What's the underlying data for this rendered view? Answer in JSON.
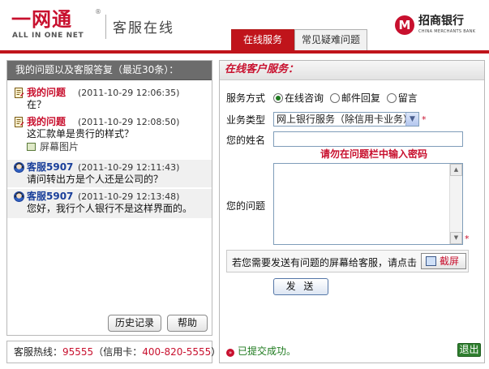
{
  "header": {
    "brand": "一网通",
    "brand_reg": "®",
    "brand_sub": "ALL IN ONE NET",
    "service_title": "客服在线",
    "bank_mark": "M",
    "bank_name": "招商银行",
    "bank_name_en": "CHINA MERCHANTS BANK",
    "tabs": [
      {
        "label": "在线服务",
        "active": true
      },
      {
        "label": "常见疑难问题",
        "active": false
      }
    ]
  },
  "left_panel": {
    "title": "我的问题以及客服答复（最近30条）：",
    "messages": [
      {
        "sender": "我的问题",
        "time": "(2011-10-29 12:06:35)",
        "text": "在？",
        "type": "user"
      },
      {
        "sender": "我的问题",
        "time": "(2011-10-29 12:08:50)",
        "text": "这汇款单是贵行的样式？",
        "type": "user",
        "attachment": "屏幕图片"
      },
      {
        "sender": "客服5907",
        "time": "(2011-10-29 12:11:43)",
        "text": "请问转出方是个人还是公司的？",
        "type": "agent"
      },
      {
        "sender": "客服5907",
        "time": "(2011-10-29 12:13:48)",
        "text": "您好，我行个人银行不是这样界面的。",
        "type": "agent"
      }
    ],
    "history_button": "历史记录",
    "help_button": "帮助"
  },
  "hotline": {
    "label": "客服热线：",
    "number": "95555",
    "credit_label": "（信用卡：",
    "credit_number": "400-820-5555",
    "suffix": "）"
  },
  "right_panel": {
    "title": "在线客户服务：",
    "service_mode_label": "服务方式",
    "service_modes": [
      {
        "label": "在线咨询",
        "selected": true
      },
      {
        "label": "邮件回复",
        "selected": false
      },
      {
        "label": "留言",
        "selected": false
      }
    ],
    "business_type_label": "业务类型",
    "business_type_value": "网上银行服务（除信用卡业务）",
    "required_mark": "*",
    "name_label": "您的姓名",
    "name_value": "",
    "warning": "请勿在问题栏中输入密码",
    "question_label": "您的问题",
    "question_value": "",
    "capture_prompt": "若您需要发送有问题的屏幕给客服，请点击",
    "capture_button": "截屏",
    "send_button": "发 送",
    "status_icon": "»",
    "status_text": "已提交成功。",
    "exit_button": "退出"
  },
  "colors": {
    "brand_red": "#c0141b",
    "agent_blue": "#1a3f9a",
    "success_green": "#1e7a1e"
  }
}
